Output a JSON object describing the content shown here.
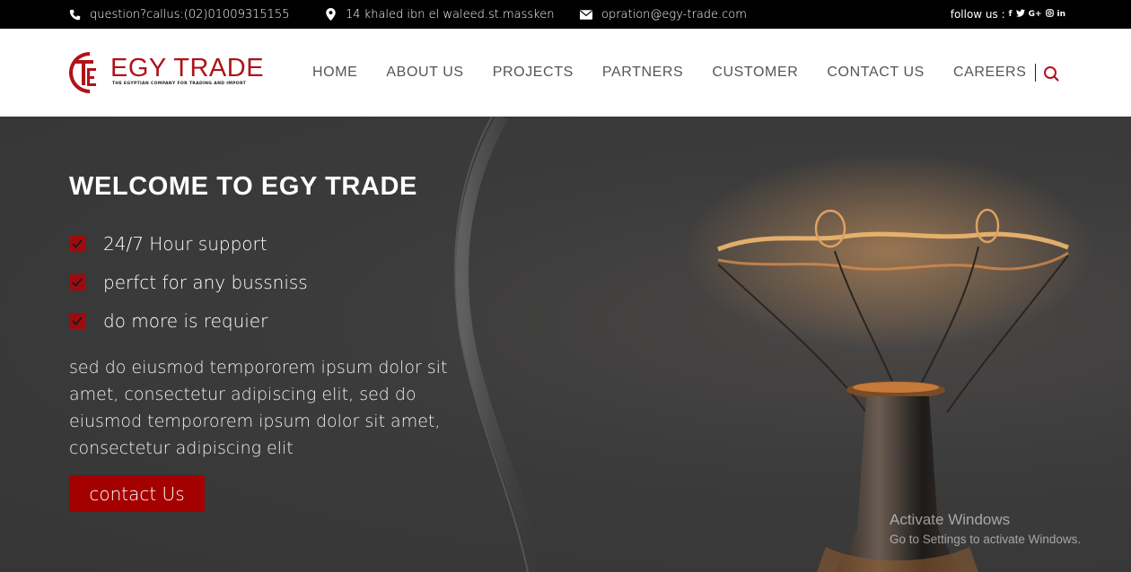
{
  "topbar": {
    "phone": "question?callus:(02)01009315155",
    "address": "14 khaled ibn el waleed.st.massken",
    "email": "opration@egy-trade.com",
    "follow_label": "follow us :",
    "social": [
      "facebook-icon",
      "twitter-icon",
      "google-plus-icon",
      "instagram-icon",
      "linkedin-icon"
    ]
  },
  "logo": {
    "name": "EGY TRADE",
    "tagline": "THE EGYPTIAN COMPANY FOR TRADING AND IMPORT",
    "brand_color": "#b0121a"
  },
  "nav": {
    "items": [
      {
        "label": "HOME"
      },
      {
        "label": "ABOUT US"
      },
      {
        "label": "PROJECTS"
      },
      {
        "label": "PARTNERS"
      },
      {
        "label": "CUSTOMER"
      },
      {
        "label": "CONTACT US"
      },
      {
        "label": "CAREERS"
      }
    ]
  },
  "hero": {
    "title": "WELCOME TO EGY TRADE",
    "features": [
      "24/7 Hour support",
      "perfct for any bussniss",
      "do more is requier"
    ],
    "text": "sed do eiusmod tempororem ipsum dolor sit amet, consectetur adipiscing elit, sed do eiusmod tempororem ipsum dolor sit amet, consectetur adipiscing elit",
    "cta_label": "contact Us",
    "accent_color": "#a40000"
  },
  "watermark": {
    "line1": "Activate Windows",
    "line2": "Go to Settings to activate Windows."
  }
}
